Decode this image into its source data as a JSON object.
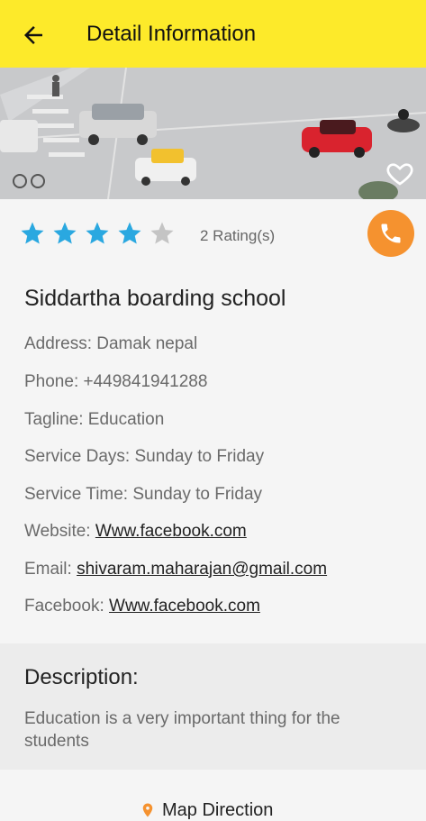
{
  "header": {
    "title": "Detail Information",
    "back_icon": "arrow-left-icon"
  },
  "hero": {
    "favorite_icon": "heart-outline-icon"
  },
  "rating": {
    "stars": 4,
    "max": 5,
    "count_text": "2 Rating(s)",
    "star_color": "#2aa8e0",
    "empty_color": "#c4c4c4"
  },
  "call": {
    "icon": "phone-icon",
    "color": "#f5922f"
  },
  "listing": {
    "name": "Siddartha boarding school",
    "address_label": "Address:",
    "address": "Damak nepal",
    "phone_label": "Phone:",
    "phone": "+449841941288",
    "tagline_label": "Tagline:",
    "tagline": "Education",
    "days_label": "Service Days:",
    "days": "Sunday to Friday",
    "time_label": "Service Time:",
    "time": "Sunday to Friday",
    "website_label": "Website:",
    "website": "Www.facebook.com",
    "email_label": "Email:",
    "email": "shivaram.maharajan@gmail.com",
    "facebook_label": "Facebook:",
    "facebook": "Www.facebook.com"
  },
  "description": {
    "title": "Description:",
    "text": "Education is a very important thing for the students"
  },
  "map": {
    "label": "Map Direction",
    "icon": "location-pin-icon"
  },
  "colors": {
    "accent": "#fdea2a"
  }
}
